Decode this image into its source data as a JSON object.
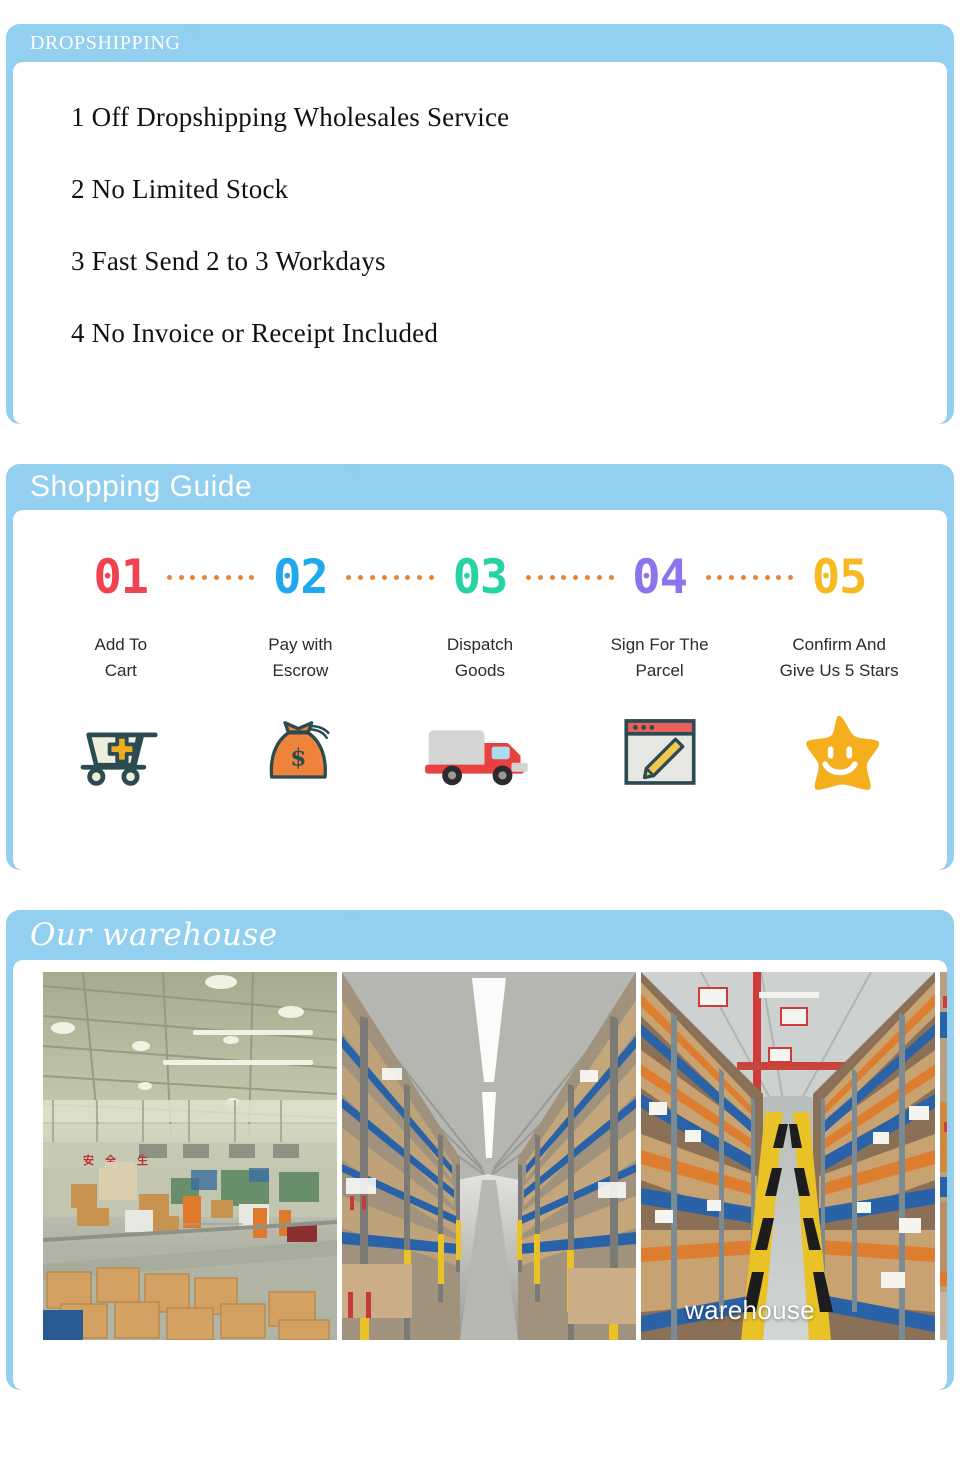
{
  "theme": {
    "frame_blue": "#93cfef",
    "panel_white": "#ffffff",
    "dot_orange": "#e8833a",
    "text_dark": "#111111"
  },
  "dropshipping": {
    "tab_label": "DROPSHIPPING",
    "items": [
      "1 Off Dropshipping Wholesales Service",
      "2 No Limited  Stock",
      "3  Fast Send 2 to 3 Workdays",
      "4  No Invoice or Receipt Included"
    ]
  },
  "shopping_guide": {
    "tab_label": "Shopping Guide",
    "steps": [
      {
        "number": "01",
        "color": "#f0434f",
        "line1": "Add To",
        "line2": "Cart",
        "icon": "shopping-cart-icon"
      },
      {
        "number": "02",
        "color": "#1fa8ee",
        "line1": "Pay with",
        "line2": "Escrow",
        "icon": "money-bag-icon"
      },
      {
        "number": "03",
        "color": "#25d4a0",
        "line1": "Dispatch",
        "line2": "Goods",
        "icon": "delivery-truck-icon"
      },
      {
        "number": "04",
        "color": "#8b74ec",
        "line1": "Sign For The",
        "line2": "Parcel",
        "icon": "sign-document-icon"
      },
      {
        "number": "05",
        "color": "#f5b921",
        "line1": "Confirm And",
        "line2": "Give Us 5 Stars",
        "icon": "smiling-star-icon"
      }
    ],
    "connector_dot_count": 8
  },
  "warehouse": {
    "tab_label": "Our warehouse",
    "photos": [
      {
        "alt": "factory floor with steel beams and cardboard boxes",
        "caption": ""
      },
      {
        "alt": "warehouse aisle with blue pallet racking",
        "caption": ""
      },
      {
        "alt": "warehouse aisle with orange taped cartons",
        "caption": "warehouse"
      }
    ]
  }
}
